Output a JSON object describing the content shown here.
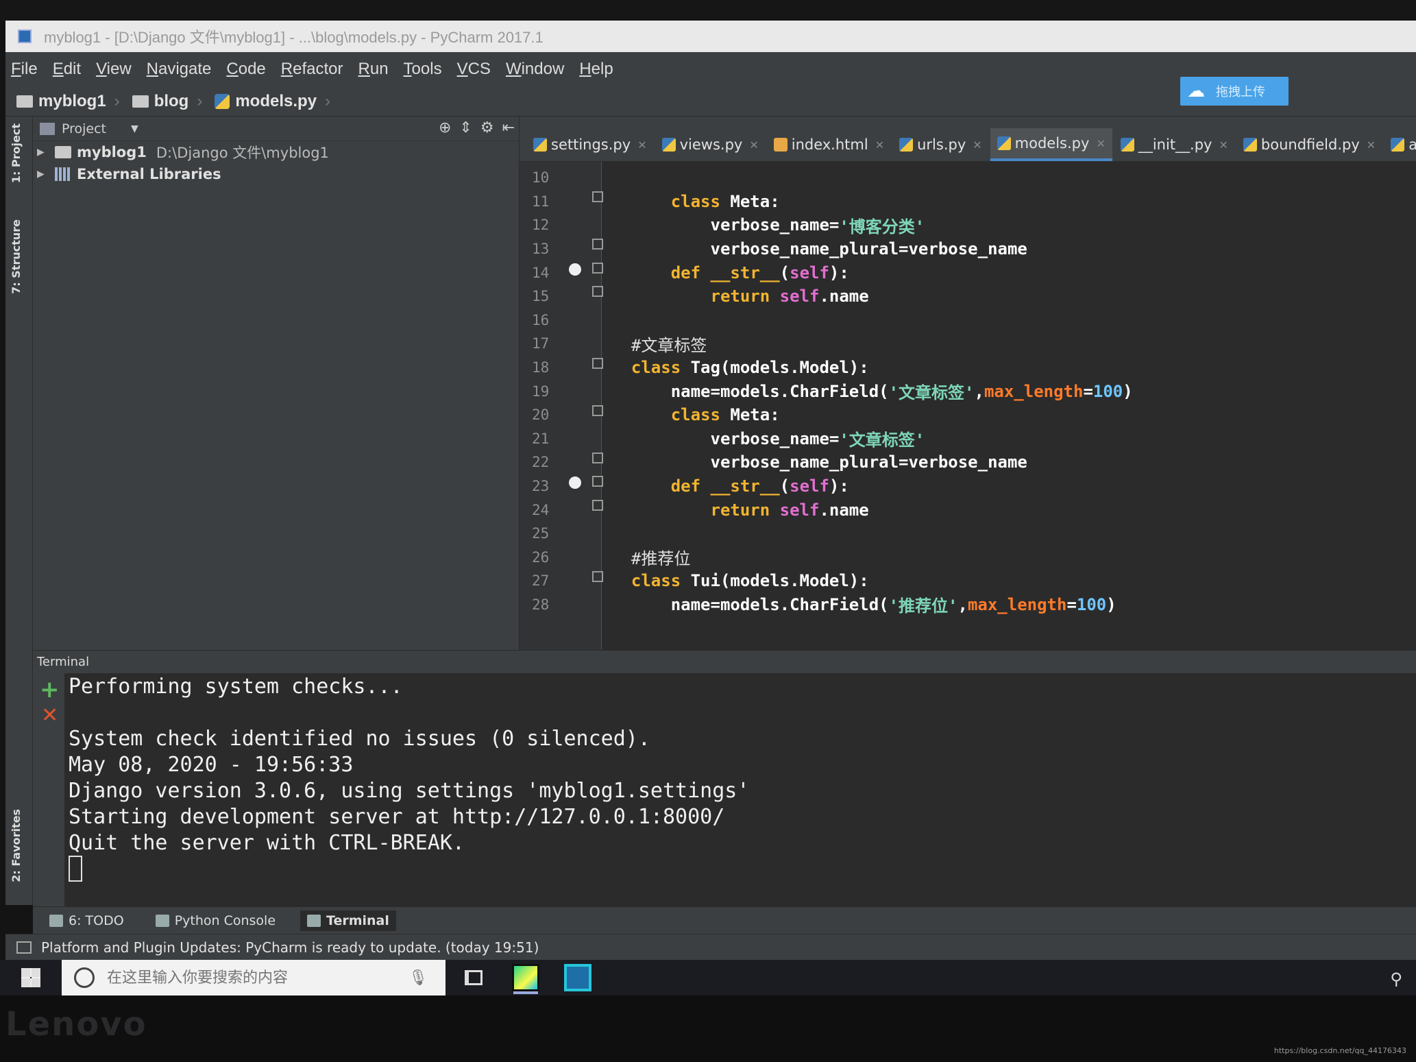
{
  "window": {
    "title": "myblog1 - [D:\\Django 文件\\myblog1] - ...\\blog\\models.py - PyCharm 2017.1"
  },
  "menu": [
    "File",
    "Edit",
    "View",
    "Navigate",
    "Code",
    "Refactor",
    "Run",
    "Tools",
    "VCS",
    "Window",
    "Help"
  ],
  "upload_button": {
    "label": "拖拽上传"
  },
  "breadcrumb": [
    "myblog1",
    "blog",
    "models.py"
  ],
  "side_tabs": {
    "project": "1: Project",
    "structure": "7: Structure",
    "favorites": "2: Favorites"
  },
  "project_panel": {
    "header": "Project",
    "tree": [
      {
        "name": "myblog1",
        "path": "D:\\Django 文件\\myblog1"
      },
      {
        "name": "External Libraries",
        "path": ""
      }
    ]
  },
  "tabs": [
    {
      "label": "settings.py",
      "active": false
    },
    {
      "label": "views.py",
      "active": false
    },
    {
      "label": "index.html",
      "active": false
    },
    {
      "label": "urls.py",
      "active": false
    },
    {
      "label": "models.py",
      "active": true
    },
    {
      "label": "__init__.py",
      "active": false
    },
    {
      "label": "boundfield.py",
      "active": false
    },
    {
      "label": "admin.py",
      "active": false
    }
  ],
  "line_numbers": [
    "10",
    "11",
    "12",
    "13",
    "14",
    "15",
    "16",
    "17",
    "18",
    "19",
    "20",
    "21",
    "22",
    "23",
    "24",
    "25",
    "26",
    "27",
    "28"
  ],
  "code": {
    "l10": "",
    "l11_kw": "class",
    "l11_rest": " Meta:",
    "l12_a": "verbose_name=",
    "l12_s": "'博客分类'",
    "l13": "verbose_name_plural=verbose_name",
    "l14_kw": "def",
    "l14_fn": "__str__",
    "l14_open": "(",
    "l14_self": "self",
    "l14_close": "):",
    "l15_kw": "return",
    "l15_self": "self",
    "l15_rest": ".name",
    "l17": "#文章标签",
    "l18_kw": "class",
    "l18_rest": " Tag(models.Model):",
    "l19_a": "name=models.CharField(",
    "l19_s": "'文章标签'",
    "l19_comma": ",",
    "l19_p": "max_length",
    "l19_eq": "=",
    "l19_n": "100",
    "l19_end": ")",
    "l20_kw": "class",
    "l20_rest": " Meta:",
    "l21_a": "verbose_name=",
    "l21_s": "'文章标签'",
    "l22": "verbose_name_plural=verbose_name",
    "l23_kw": "def",
    "l23_fn": "__str__",
    "l23_open": "(",
    "l23_self": "self",
    "l23_close": "):",
    "l24_kw": "return",
    "l24_self": "self",
    "l24_rest": ".name",
    "l26": "#推荐位",
    "l27_kw": "class",
    "l27_rest": " Tui(models.Model):",
    "l28_a": "name=models.CharField(",
    "l28_s": "'推荐位'",
    "l28_comma": ",",
    "l28_p": "max_length",
    "l28_eq": "=",
    "l28_n": "100",
    "l28_end": ")"
  },
  "terminal": {
    "header": "Terminal",
    "lines": [
      "Performing system checks...",
      "",
      "System check identified no issues (0 silenced).",
      "May 08, 2020 - 19:56:33",
      "Django version 3.0.6, using settings 'myblog1.settings'",
      "Starting development server at http://127.0.0.1:8000/",
      "Quit the server with CTRL-BREAK."
    ]
  },
  "bottom_tabs": [
    "6: TODO",
    "Python Console",
    "Terminal"
  ],
  "status": {
    "message": "Platform and Plugin Updates: PyCharm is ready to update. (today 19:51)"
  },
  "taskbar": {
    "search_placeholder": "在这里输入你要搜索的内容"
  },
  "bezel": {
    "brand": "Lenovo",
    "watermark": "https://blog.csdn.net/qq_44176343"
  },
  "colors": {
    "editor_bg": "#2b2b2b",
    "keyword": "#f2b430",
    "string": "#7ed6b8",
    "self": "#e26fd1",
    "param": "#ff7b2a",
    "number": "#6fc5ff",
    "accent": "#4a88c7"
  }
}
